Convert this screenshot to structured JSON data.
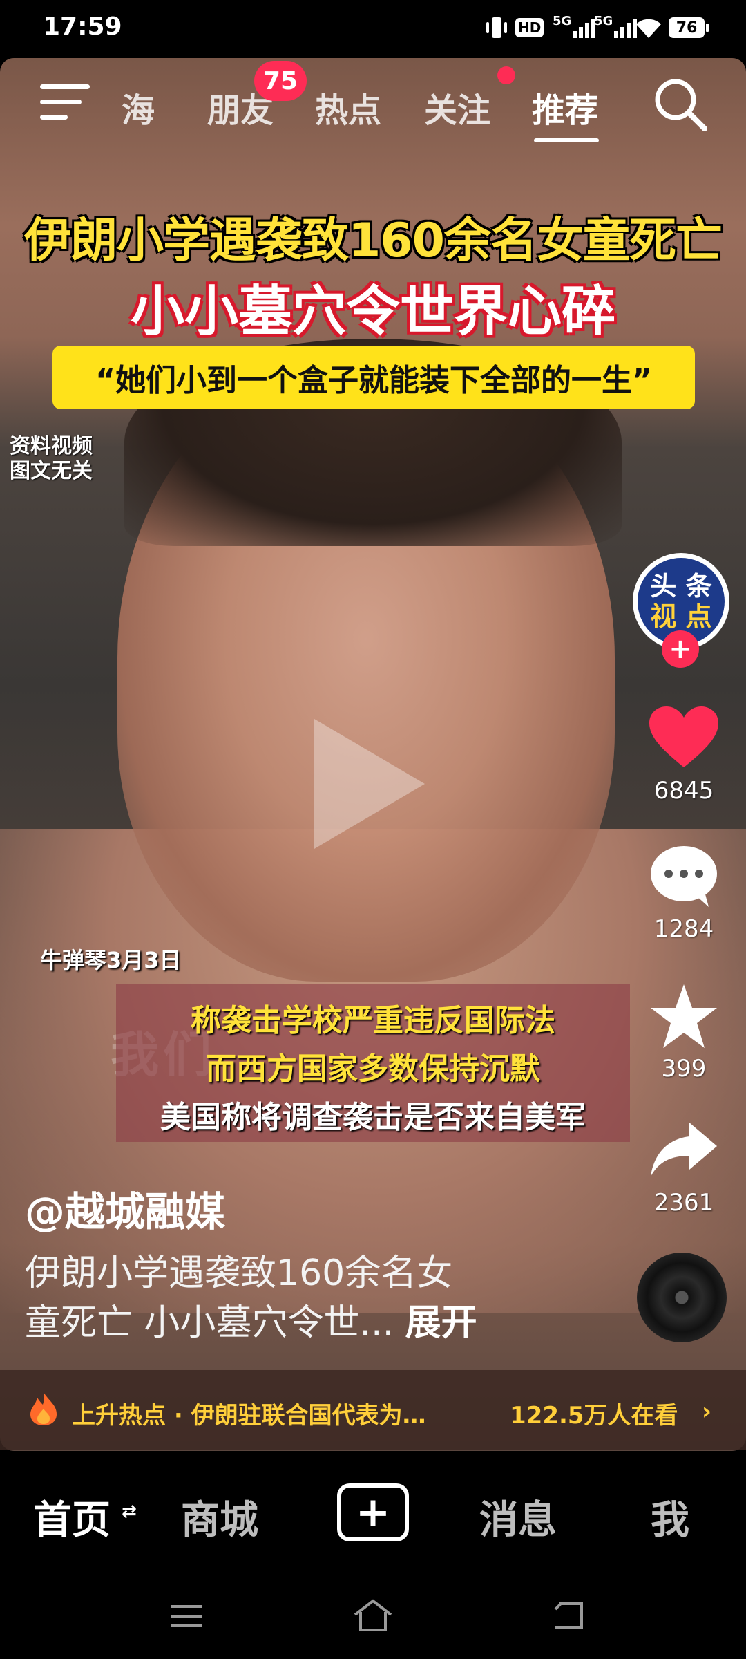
{
  "status_bar": {
    "time": "17:59",
    "hd_label": "HD",
    "net1": "5G",
    "net2": "5G",
    "battery": "76"
  },
  "top_nav": {
    "tabs": [
      "海",
      "朋友",
      "热点",
      "关注",
      "推荐"
    ],
    "active_tab": "推荐",
    "friends_badge": "75"
  },
  "video": {
    "title_line1": "伊朗小学遇袭致160余名女童死亡",
    "title_line2": "小小墓穴令世界心碎",
    "quote": "“她们小到一个盒子就能装下全部的一生”",
    "watermark_line1": "资料视频",
    "watermark_line2": "图文无关",
    "date_tag": "牛弹琴3月3日",
    "subtitle_line1": "称袭击学校严重违反国际法",
    "subtitle_line2": "而西方国家多数保持沉默",
    "subtitle_line3": "美国称将调查袭击是否来自美军",
    "faint_caption": "我们",
    "channel_logo_line1": "头 条",
    "channel_logo_line2": "视 点"
  },
  "actions": {
    "likes": "6845",
    "comments": "1284",
    "favorites": "399",
    "shares": "2361"
  },
  "post": {
    "author": "@越城融媒",
    "desc_line1": "伊朗小学遇袭致160余名女",
    "desc_line2": "童死亡 小小墓穴令世...",
    "expand_label": "展开"
  },
  "hot_bar": {
    "text": "上升热点 · 伊朗驻联合国代表为…",
    "viewers": "122.5万人在看"
  },
  "bottom_nav": {
    "home": "首页",
    "mall": "商城",
    "messages": "消息",
    "me": "我"
  },
  "colors": {
    "accent_red": "#fe2c55",
    "title_yellow": "#ffe23a",
    "quote_bg": "#ffe21a",
    "hot_text": "#ffcf3a"
  }
}
